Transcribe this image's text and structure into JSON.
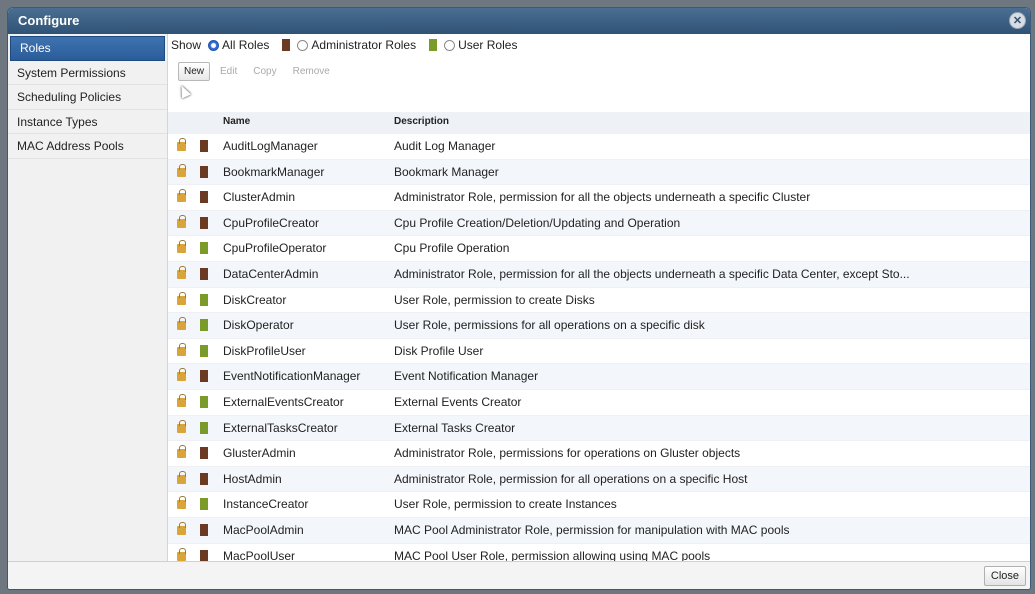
{
  "dialog": {
    "title": "Configure",
    "close_label": "Close"
  },
  "sidebar": {
    "items": [
      {
        "label": "Roles",
        "active": true
      },
      {
        "label": "System Permissions",
        "active": false
      },
      {
        "label": "Scheduling Policies",
        "active": false
      },
      {
        "label": "Instance Types",
        "active": false
      },
      {
        "label": "MAC Address Pools",
        "active": false
      }
    ]
  },
  "show": {
    "label": "Show",
    "options": [
      {
        "label": "All Roles",
        "selected": true,
        "icon": null
      },
      {
        "label": "Administrator Roles",
        "selected": false,
        "icon": "admin-person-icon"
      },
      {
        "label": "User Roles",
        "selected": false,
        "icon": "user-person-icon"
      }
    ]
  },
  "toolbar": {
    "new_label": "New",
    "edit_label": "Edit",
    "copy_label": "Copy",
    "remove_label": "Remove"
  },
  "table": {
    "headers": {
      "name": "Name",
      "description": "Description"
    },
    "rows": [
      {
        "name": "AuditLogManager",
        "description": "Audit Log Manager",
        "type": "admin"
      },
      {
        "name": "BookmarkManager",
        "description": "Bookmark Manager",
        "type": "admin"
      },
      {
        "name": "ClusterAdmin",
        "description": "Administrator Role, permission for all the objects underneath a specific Cluster",
        "type": "admin"
      },
      {
        "name": "CpuProfileCreator",
        "description": "Cpu Profile Creation/Deletion/Updating and Operation",
        "type": "admin"
      },
      {
        "name": "CpuProfileOperator",
        "description": "Cpu Profile Operation",
        "type": "user"
      },
      {
        "name": "DataCenterAdmin",
        "description": "Administrator Role, permission for all the objects underneath a specific Data Center, except Sto...",
        "type": "admin"
      },
      {
        "name": "DiskCreator",
        "description": "User Role, permission to create Disks",
        "type": "user"
      },
      {
        "name": "DiskOperator",
        "description": "User Role, permissions for all operations on a specific disk",
        "type": "user"
      },
      {
        "name": "DiskProfileUser",
        "description": "Disk Profile User",
        "type": "user"
      },
      {
        "name": "EventNotificationManager",
        "description": "Event Notification Manager",
        "type": "admin"
      },
      {
        "name": "ExternalEventsCreator",
        "description": "External Events Creator",
        "type": "user"
      },
      {
        "name": "ExternalTasksCreator",
        "description": "External Tasks Creator",
        "type": "user"
      },
      {
        "name": "GlusterAdmin",
        "description": "Administrator Role, permissions for operations on Gluster objects",
        "type": "admin"
      },
      {
        "name": "HostAdmin",
        "description": "Administrator Role, permission for all operations on a specific Host",
        "type": "admin"
      },
      {
        "name": "InstanceCreator",
        "description": "User Role, permission to create Instances",
        "type": "user"
      },
      {
        "name": "MacPoolAdmin",
        "description": "MAC Pool Administrator Role, permission for manipulation with MAC pools",
        "type": "admin"
      },
      {
        "name": "MacPoolUser",
        "description": "MAC Pool User Role, permission allowing using MAC pools",
        "type": "admin"
      }
    ]
  },
  "colors": {
    "title_bar": "#2f5275",
    "active_item": "#2a5d98",
    "admin_icon": "#6a3b22",
    "user_icon": "#9a8a2a",
    "lock_icon": "#d9a43a"
  }
}
